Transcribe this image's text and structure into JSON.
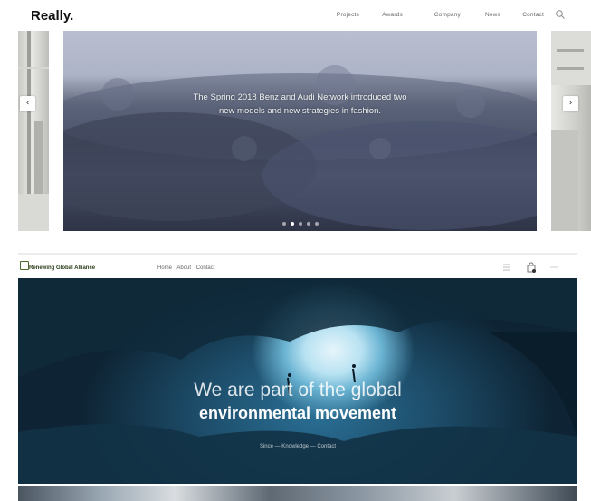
{
  "site1": {
    "logo": "Really.",
    "nav": [
      "Projects",
      "Awards",
      "Company",
      "News",
      "Contact"
    ],
    "hero_caption": {
      "line1": "The Spring 2018 Benz and Audi Network introduced two",
      "line2": "new models and new strategies in fashion."
    },
    "slide_count": 5,
    "active_slide": 1,
    "prev_icon": "chevron-left-icon",
    "next_icon": "chevron-right-icon"
  },
  "site2": {
    "logo_text": "Renewing Global Alliance",
    "nav": [
      "Home",
      "About",
      "Contact"
    ],
    "hero": {
      "line1": "We are part of the global",
      "line2": "environmental movement",
      "sub": "Since — Knowledge — Contact"
    }
  },
  "colors": {
    "page_bg": "#ffffff",
    "hero_blue": "#1d4d6a",
    "slide_blue": "#4a5168"
  }
}
